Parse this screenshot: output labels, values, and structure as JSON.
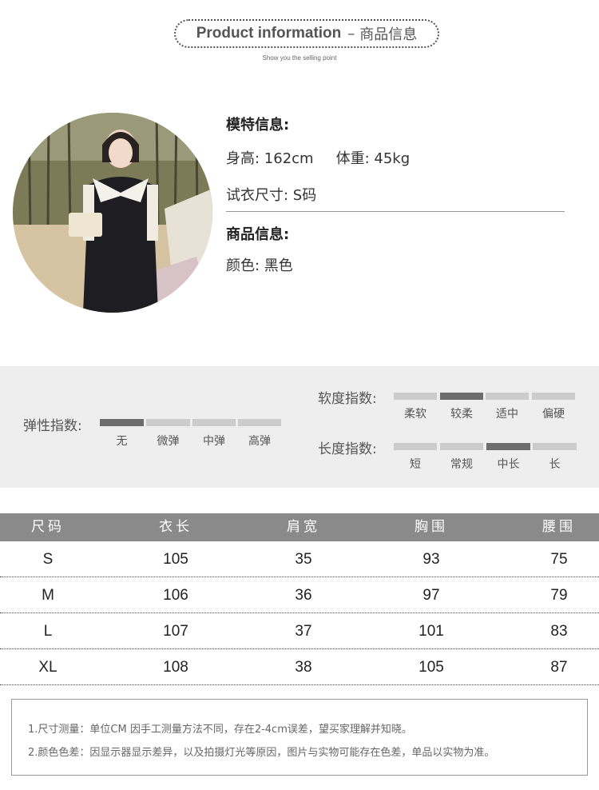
{
  "header": {
    "title_en": "Product information",
    "dash": "–",
    "title_cn": "商品信息",
    "subtitle": "Show you the selling point"
  },
  "model": {
    "heading": "模特信息:",
    "height": "身高: 162cm",
    "weight": "体重:  45kg",
    "size": "试衣尺寸:   S码"
  },
  "product": {
    "heading": "商品信息:",
    "color": "颜色:   黑色"
  },
  "indices": {
    "elasticity": {
      "label": "弹性指数:",
      "options": [
        "无",
        "微弹",
        "中弹",
        "高弹"
      ],
      "selected": 0
    },
    "softness": {
      "label": "软度指数:",
      "options": [
        "柔软",
        "较柔",
        "适中",
        "偏硬"
      ],
      "selected": 1
    },
    "length": {
      "label": "长度指数:",
      "options": [
        "短",
        "常规",
        "中长",
        "长"
      ],
      "selected": 2
    }
  },
  "size_table": {
    "headers": [
      "尺码",
      "衣长",
      "肩宽",
      "胸围",
      "腰围"
    ],
    "rows": [
      [
        "S",
        "105",
        "35",
        "93",
        "75"
      ],
      [
        "M",
        "106",
        "36",
        "97",
        "79"
      ],
      [
        "L",
        "107",
        "37",
        "101",
        "83"
      ],
      [
        "XL",
        "108",
        "38",
        "105",
        "87"
      ]
    ]
  },
  "notes": [
    "1.尺寸测量：单位CM  因手工测量方法不同，存在2-4cm误差，望买家理解并知晓。",
    "2.颜色色差：因显示器显示差异，以及拍摄灯光等原因，图片与实物可能存在色差，单品以实物为准。"
  ],
  "colors": {
    "band_bg": "#eeeeee",
    "segment_off": "#cccccc",
    "segment_on": "#6d6d6d",
    "table_header": "#8a8a8a"
  }
}
